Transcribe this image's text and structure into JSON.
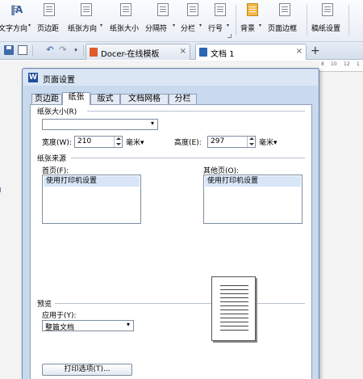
{
  "ribbon": {
    "items": [
      {
        "key": "text_direction",
        "label": "文字方向"
      },
      {
        "key": "margins",
        "label": "页边距"
      },
      {
        "key": "orientation",
        "label": "纸张方向"
      },
      {
        "key": "size",
        "label": "纸张大小"
      },
      {
        "key": "breaks",
        "label": "分隔符"
      },
      {
        "key": "columns",
        "label": "分栏"
      },
      {
        "key": "line_numbers",
        "label": "行号"
      },
      {
        "key": "background",
        "label": "背景"
      },
      {
        "key": "page_borders",
        "label": "页面边框"
      },
      {
        "key": "grid_paper",
        "label": "稿纸设置"
      }
    ]
  },
  "tabs": {
    "items": [
      {
        "label": "Docer-在线模板",
        "active": false
      },
      {
        "label": "文档 1",
        "active": true
      }
    ]
  },
  "ruler": {
    "numbers": [
      "8",
      "10",
      "12",
      "1"
    ]
  },
  "dialog": {
    "title": "页面设置",
    "icon_letter": "W",
    "tabs": [
      "页边距",
      "纸张",
      "版式",
      "文档网格",
      "分栏"
    ],
    "active_tab": "纸张",
    "paper_size": {
      "label": "纸张大小(R)",
      "selected": "",
      "width_label": "宽度(W):",
      "width_value": "210",
      "height_label": "高度(E):",
      "height_value": "297",
      "unit": "毫米"
    },
    "paper_source": {
      "label": "纸张来源",
      "first_page_label": "首页(F):",
      "first_page_selected": "使用打印机设置",
      "other_pages_label": "其他页(O):",
      "other_pages_selected": "使用打印机设置"
    },
    "preview": {
      "label": "预览",
      "apply_to_label": "应用于(Y):",
      "apply_to_value": "整篇文档",
      "print_options_button": "打印选项(T)..."
    }
  }
}
